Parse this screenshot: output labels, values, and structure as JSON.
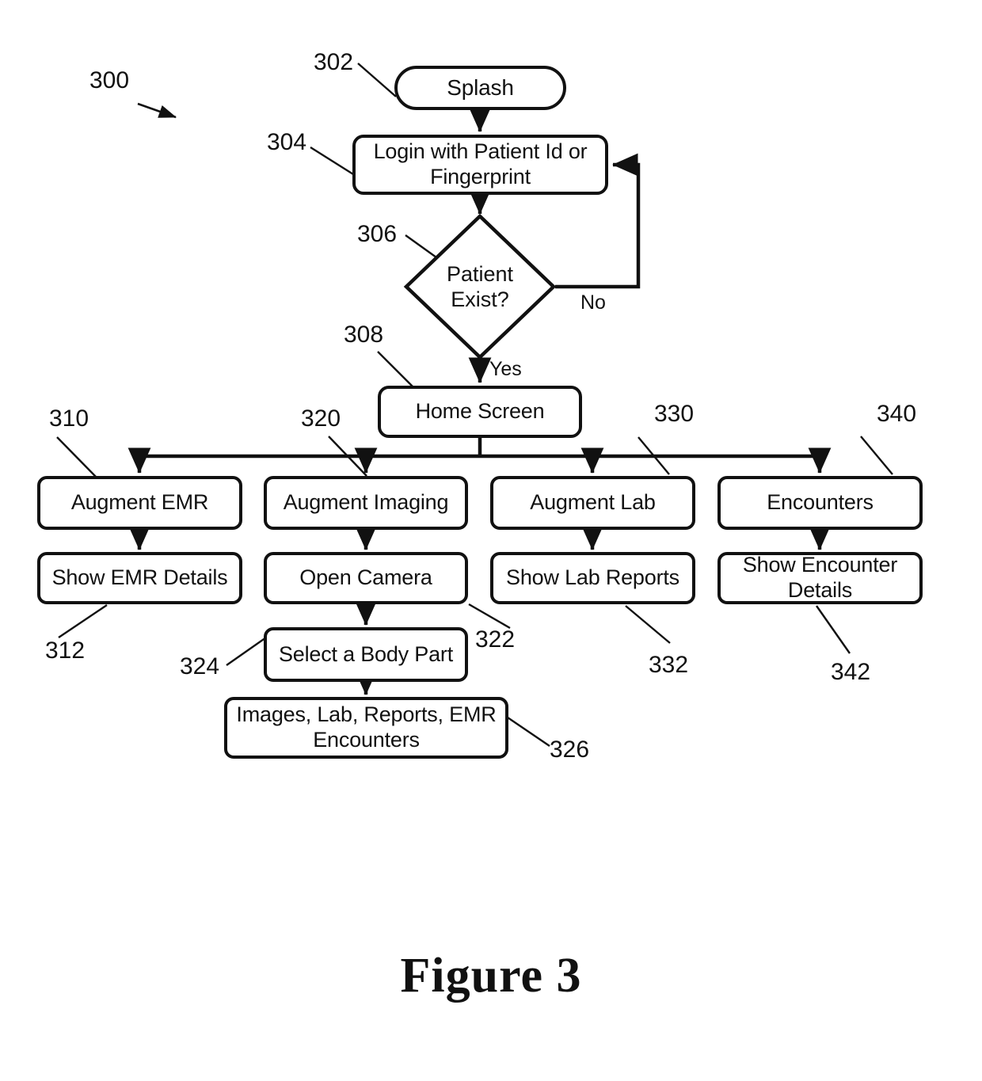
{
  "figure": {
    "caption": "Figure 3",
    "system_ref": "300"
  },
  "nodes": {
    "splash": {
      "label": "Splash",
      "ref": "302"
    },
    "login": {
      "label": "Login with Patient Id or Fingerprint",
      "ref": "304"
    },
    "decision": {
      "label_line1": "Patient",
      "label_line2": "Exist?",
      "ref": "306"
    },
    "home_screen": {
      "label": "Home Screen",
      "ref": "308"
    },
    "augment_emr": {
      "label": "Augment EMR",
      "ref": "310"
    },
    "show_emr_details": {
      "label": "Show EMR Details",
      "ref": "312"
    },
    "augment_imaging": {
      "label": "Augment Imaging",
      "ref": "320"
    },
    "open_camera": {
      "label": "Open Camera",
      "ref": "322"
    },
    "select_body_part": {
      "label": "Select a Body Part",
      "ref": "324"
    },
    "images_lab_reports": {
      "label": "Images, Lab, Reports, EMR Encounters",
      "ref": "326"
    },
    "augment_lab": {
      "label": "Augment Lab",
      "ref": "330"
    },
    "show_lab_reports": {
      "label": "Show Lab Reports",
      "ref": "332"
    },
    "encounters": {
      "label": "Encounters",
      "ref": "340"
    },
    "show_encounter_details": {
      "label": "Show Encounter Details",
      "ref": "342"
    }
  },
  "edge_labels": {
    "yes": "Yes",
    "no": "No"
  },
  "colors": {
    "stroke": "#111111",
    "fill": "#ffffff",
    "background": "#ffffff"
  },
  "diagram_data": {
    "type": "flowchart",
    "title": "Figure 3",
    "orientation": "top-to-bottom",
    "flow": [
      {
        "from": "splash",
        "to": "login",
        "label": ""
      },
      {
        "from": "login",
        "to": "decision",
        "label": ""
      },
      {
        "from": "decision",
        "to": "login",
        "label": "No"
      },
      {
        "from": "decision",
        "to": "home_screen",
        "label": "Yes"
      },
      {
        "from": "home_screen",
        "to": "augment_emr",
        "label": ""
      },
      {
        "from": "home_screen",
        "to": "augment_imaging",
        "label": ""
      },
      {
        "from": "home_screen",
        "to": "augment_lab",
        "label": ""
      },
      {
        "from": "home_screen",
        "to": "encounters",
        "label": ""
      },
      {
        "from": "augment_emr",
        "to": "show_emr_details",
        "label": ""
      },
      {
        "from": "augment_imaging",
        "to": "open_camera",
        "label": ""
      },
      {
        "from": "open_camera",
        "to": "select_body_part",
        "label": ""
      },
      {
        "from": "select_body_part",
        "to": "images_lab_reports",
        "label": ""
      },
      {
        "from": "augment_lab",
        "to": "show_lab_reports",
        "label": ""
      },
      {
        "from": "encounters",
        "to": "show_encounter_details",
        "label": ""
      }
    ]
  }
}
